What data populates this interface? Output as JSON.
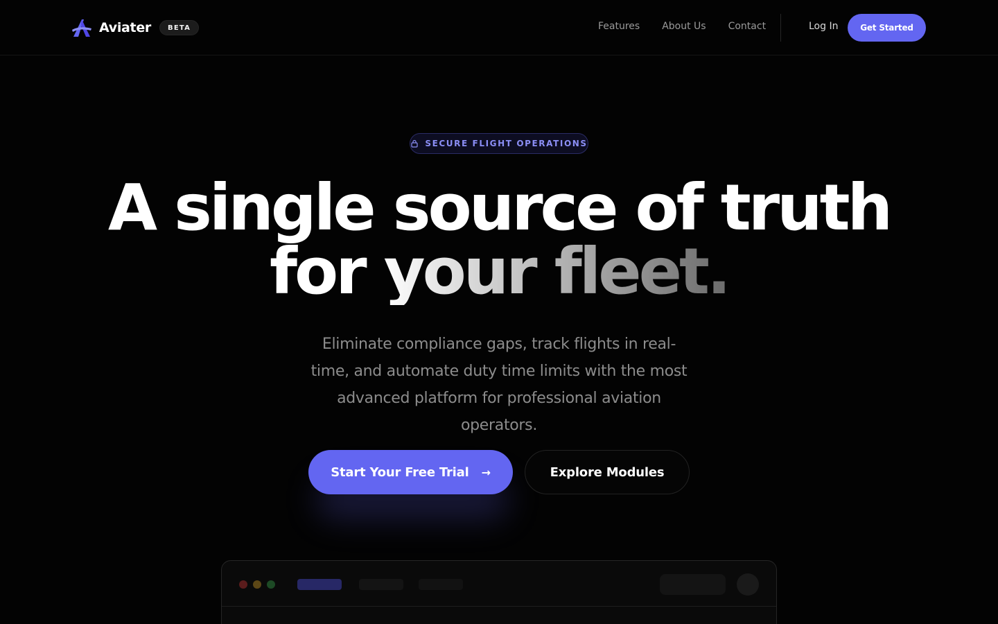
{
  "nav": {
    "brand": "Aviater",
    "badge": "BETA",
    "links": [
      "Features",
      "About Us",
      "Contact"
    ],
    "login": "Log In",
    "cta": "Get Started"
  },
  "hero": {
    "pill": "SECURE FLIGHT OPERATIONS",
    "headline_line1": "A single source of truth",
    "headline_line2": "for your fleet.",
    "subheadline": "Eliminate compliance gaps, track flights in real-time, and automate duty time limits with the most advanced platform for professional aviation operators.",
    "primary_cta": "Start Your Free Trial",
    "primary_cta_icon": "arrow-right-icon",
    "secondary_cta": "Explore Modules"
  },
  "colors": {
    "accent": "#6366f1",
    "background": "#030303",
    "pill_text": "#8b8ef5"
  },
  "icons": {
    "logo": "aviater-logo-icon",
    "pill": "lock-icon"
  }
}
